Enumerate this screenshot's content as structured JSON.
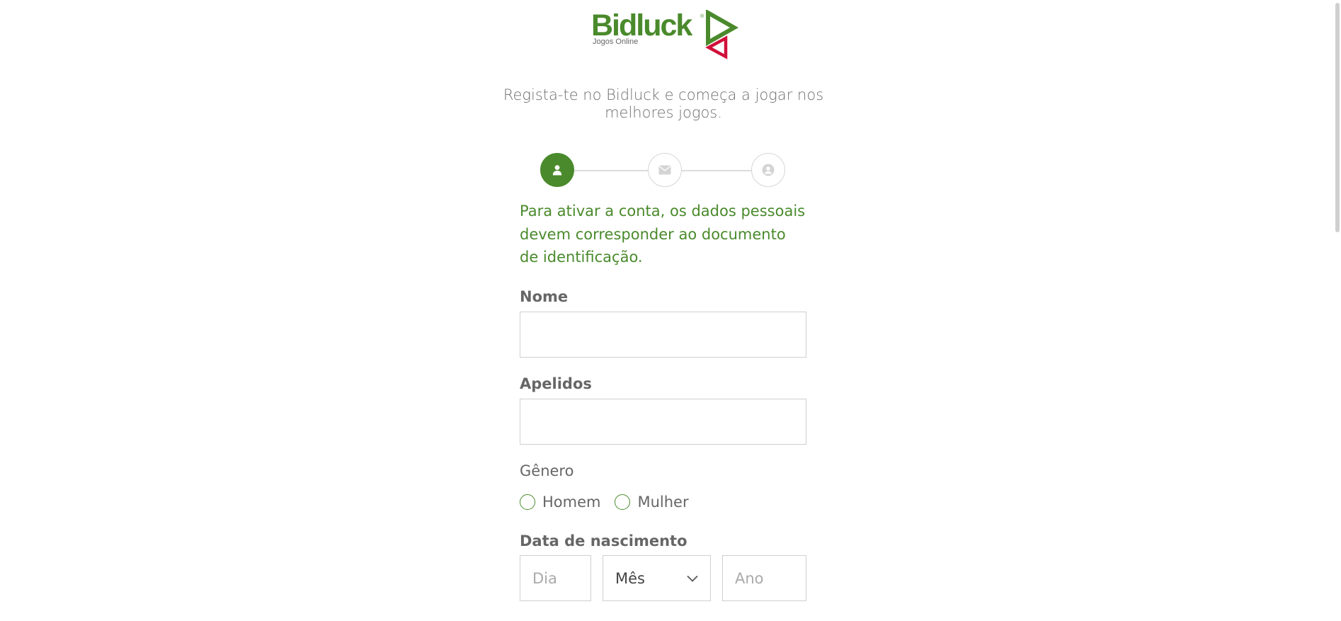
{
  "brand": {
    "name": "Bidluck",
    "registered_mark": "®",
    "tagline": "Jogos Online",
    "primary_color": "#4a8a2c",
    "accent_color": "#d0103a"
  },
  "header": {
    "subtitle": "Regista-te no Bidluck e começa a jogar nos melhores jogos."
  },
  "steps": [
    {
      "icon": "user-icon",
      "state": "active"
    },
    {
      "icon": "envelope-icon",
      "state": "inactive"
    },
    {
      "icon": "user-circle-icon",
      "state": "inactive"
    }
  ],
  "form": {
    "notice": "Para ativar a conta, os dados pessoais devem corresponder ao documento de identificação.",
    "first_name": {
      "label": "Nome",
      "value": "",
      "placeholder": ""
    },
    "last_name": {
      "label": "Apelidos",
      "value": "",
      "placeholder": ""
    },
    "gender": {
      "label": "Gênero",
      "options": [
        "Homem",
        "Mulher"
      ],
      "selected": null
    },
    "birth_date": {
      "label": "Data de nascimento",
      "day_placeholder": "Dia",
      "month_selected": "Mês",
      "year_placeholder": "Ano"
    }
  }
}
